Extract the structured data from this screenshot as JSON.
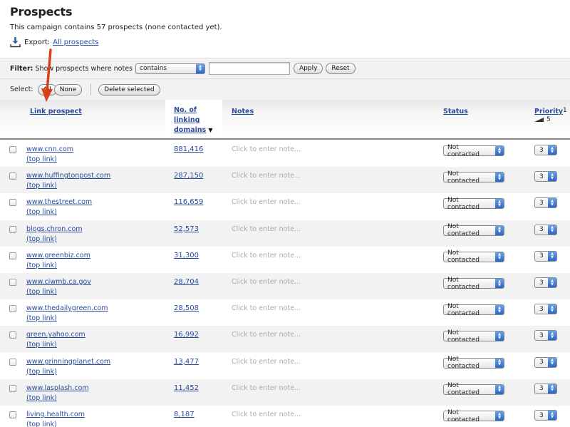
{
  "page": {
    "title": "Prospects",
    "summary": "This campaign contains 57 prospects (none contacted yet).",
    "export_label": "Export:",
    "export_link": "All prospects"
  },
  "filter": {
    "label": "Filter:",
    "text": "Show prospects where notes",
    "operator": "contains",
    "value": "",
    "apply": "Apply",
    "reset": "Reset"
  },
  "selection": {
    "label": "Select:",
    "all": "All",
    "none": "None",
    "delete": "Delete selected"
  },
  "table": {
    "headers": {
      "prospect": "Link prospect",
      "domains_1": "No. of",
      "domains_2": "linking",
      "domains_3": "domains",
      "notes": "Notes",
      "status": "Status",
      "priority": "Priority",
      "priority_high": "1",
      "priority_low": "5"
    },
    "rows": [
      {
        "site": "www.cnn.com",
        "top_link": "(top link)",
        "domains": "881,416",
        "note": "Click to enter note...",
        "status": "Not contacted",
        "priority": "3"
      },
      {
        "site": "www.huffingtonpost.com",
        "top_link": "(top link)",
        "domains": "287,150",
        "note": "Click to enter note...",
        "status": "Not contacted",
        "priority": "3"
      },
      {
        "site": "www.thestreet.com",
        "top_link": "(top link)",
        "domains": "116,659",
        "note": "Click to enter note...",
        "status": "Not contacted",
        "priority": "3"
      },
      {
        "site": "blogs.chron.com",
        "top_link": "(top link)",
        "domains": "52,573",
        "note": "Click to enter note...",
        "status": "Not contacted",
        "priority": "3"
      },
      {
        "site": "www.greenbiz.com",
        "top_link": "(top link)",
        "domains": "31,300",
        "note": "Click to enter note...",
        "status": "Not contacted",
        "priority": "3"
      },
      {
        "site": "www.ciwmb.ca.gov",
        "top_link": "(top link)",
        "domains": "28,704",
        "note": "Click to enter note...",
        "status": "Not contacted",
        "priority": "3"
      },
      {
        "site": "www.thedailygreen.com",
        "top_link": "(top link)",
        "domains": "28,508",
        "note": "Click to enter note...",
        "status": "Not contacted",
        "priority": "3"
      },
      {
        "site": "green.yahoo.com",
        "top_link": "(top link)",
        "domains": "16,992",
        "note": "Click to enter note...",
        "status": "Not contacted",
        "priority": "3"
      },
      {
        "site": "www.grinningplanet.com",
        "top_link": "(top link)",
        "domains": "13,477",
        "note": "Click to enter note...",
        "status": "Not contacted",
        "priority": "3"
      },
      {
        "site": "www.lasplash.com",
        "top_link": "(top link)",
        "domains": "11,452",
        "note": "Click to enter note...",
        "status": "Not contacted",
        "priority": "3"
      },
      {
        "site": "living.health.com",
        "top_link": "(top link)",
        "domains": "8,187",
        "note": "Click to enter note...",
        "status": "Not contacted",
        "priority": "3"
      }
    ]
  },
  "colors": {
    "link": "#2a4b9c",
    "annotation_arrow": "#d8401c",
    "select_arrow": "#2d66c6"
  },
  "icons": {
    "export": "download-icon",
    "sort": "sort-desc-icon",
    "annotation": "red-arrow-annotation"
  }
}
